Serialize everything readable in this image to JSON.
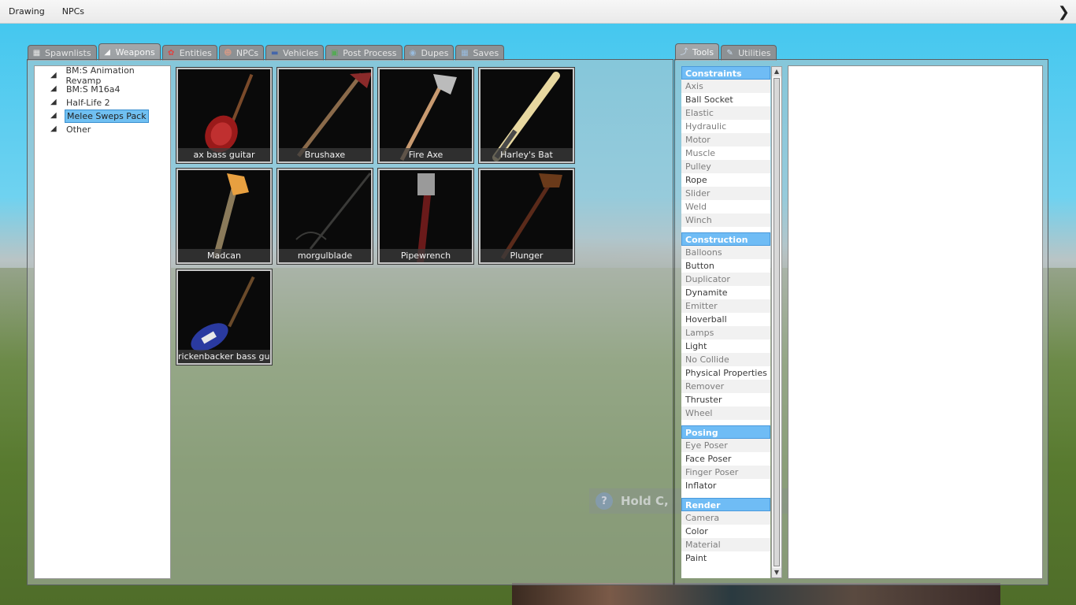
{
  "menubar": {
    "items": [
      "Drawing",
      "NPCs"
    ],
    "arrow_icon": "chevron-right-icon"
  },
  "spawn_tabs": [
    {
      "label": "Spawnlists",
      "icon": "grid-icon"
    },
    {
      "label": "Weapons",
      "icon": "pistol-icon"
    },
    {
      "label": "Entities",
      "icon": "entity-icon"
    },
    {
      "label": "NPCs",
      "icon": "monkey-icon"
    },
    {
      "label": "Vehicles",
      "icon": "car-icon"
    },
    {
      "label": "Post Process",
      "icon": "picture-icon"
    },
    {
      "label": "Dupes",
      "icon": "dupe-icon"
    },
    {
      "label": "Saves",
      "icon": "save-icon"
    }
  ],
  "active_spawn_tab": "Weapons",
  "tool_tabs": [
    {
      "label": "Tools",
      "icon": "wrench-icon"
    },
    {
      "label": "Utilities",
      "icon": "utilities-icon"
    }
  ],
  "weapon_categories": [
    "BM:S Animation Revamp",
    "BM:S M16a4",
    "Half-Life 2",
    "Melee Sweps Pack",
    "Other"
  ],
  "selected_category": "Melee Sweps Pack",
  "weapons": [
    "ax bass guitar",
    "Brushaxe",
    "Fire Axe",
    "Harley's Bat",
    "Madcan",
    "morgulblade",
    "Pipewrench",
    "Plunger",
    "rickenbacker bass guitar"
  ],
  "tool_groups": [
    {
      "name": "Constraints",
      "tools": [
        "Axis",
        "Ball Socket",
        "Elastic",
        "Hydraulic",
        "Motor",
        "Muscle",
        "Pulley",
        "Rope",
        "Slider",
        "Weld",
        "Winch"
      ]
    },
    {
      "name": "Construction",
      "tools": [
        "Balloons",
        "Button",
        "Duplicator",
        "Dynamite",
        "Emitter",
        "Hoverball",
        "Lamps",
        "Light",
        "No Collide",
        "Physical Properties",
        "Remover",
        "Thruster",
        "Wheel"
      ]
    },
    {
      "name": "Posing",
      "tools": [
        "Eye Poser",
        "Face Poser",
        "Finger Poser",
        "Inflator"
      ]
    },
    {
      "name": "Render",
      "tools": [
        "Camera",
        "Color",
        "Material",
        "Paint"
      ]
    }
  ],
  "hint": {
    "icon": "question-icon",
    "text": "Hold C,"
  }
}
